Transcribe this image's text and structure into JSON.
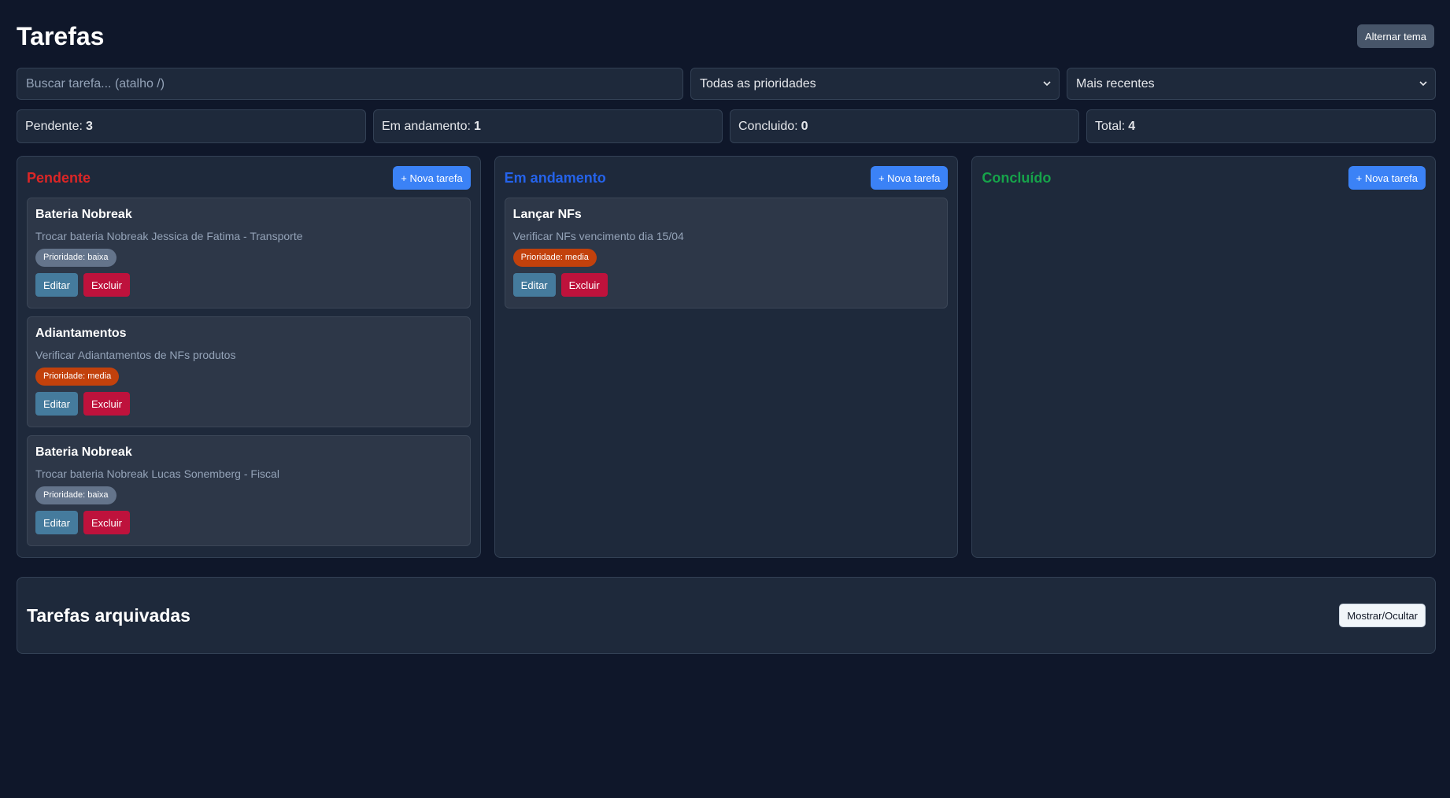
{
  "header": {
    "title": "Tarefas",
    "theme_button": "Alternar tema"
  },
  "filters": {
    "search_placeholder": "Buscar tarefa... (atalho /)",
    "priority_selected": "Todas as prioridades",
    "sort_selected": "Mais recentes"
  },
  "stats": [
    {
      "label": "Pendente:",
      "value": "3"
    },
    {
      "label": "Em andamento:",
      "value": "1"
    },
    {
      "label": "Concluido:",
      "value": "0"
    },
    {
      "label": "Total:",
      "value": "4"
    }
  ],
  "columns": [
    {
      "title": "Pendente",
      "color": "#dc2626",
      "new_button": "+ Nova tarefa",
      "cards": [
        {
          "title": "Bateria Nobreak",
          "description": "Trocar bateria Nobreak Jessica de Fatima - Transporte",
          "priority": "Prioridade: baixa",
          "priority_color": "#64748b",
          "edit": "Editar",
          "delete": "Excluir"
        },
        {
          "title": "Adiantamentos",
          "description": "Verificar Adiantamentos de NFs produtos",
          "priority": "Prioridade: media",
          "priority_color": "#c2410c",
          "edit": "Editar",
          "delete": "Excluir"
        },
        {
          "title": "Bateria Nobreak",
          "description": "Trocar bateria Nobreak Lucas Sonemberg - Fiscal",
          "priority": "Prioridade: baixa",
          "priority_color": "#64748b",
          "edit": "Editar",
          "delete": "Excluir"
        }
      ]
    },
    {
      "title": "Em andamento",
      "color": "#2563eb",
      "new_button": "+ Nova tarefa",
      "cards": [
        {
          "title": "Lançar NFs",
          "description": "Verificar NFs vencimento dia 15/04",
          "priority": "Prioridade: media",
          "priority_color": "#c2410c",
          "edit": "Editar",
          "delete": "Excluir"
        }
      ]
    },
    {
      "title": "Concluído",
      "color": "#16a34a",
      "new_button": "+ Nova tarefa",
      "cards": []
    }
  ],
  "archive": {
    "title": "Tarefas arquivadas",
    "toggle_button": "Mostrar/Ocultar"
  },
  "icons": {
    "select_chevron": "chevron-down-icon"
  }
}
